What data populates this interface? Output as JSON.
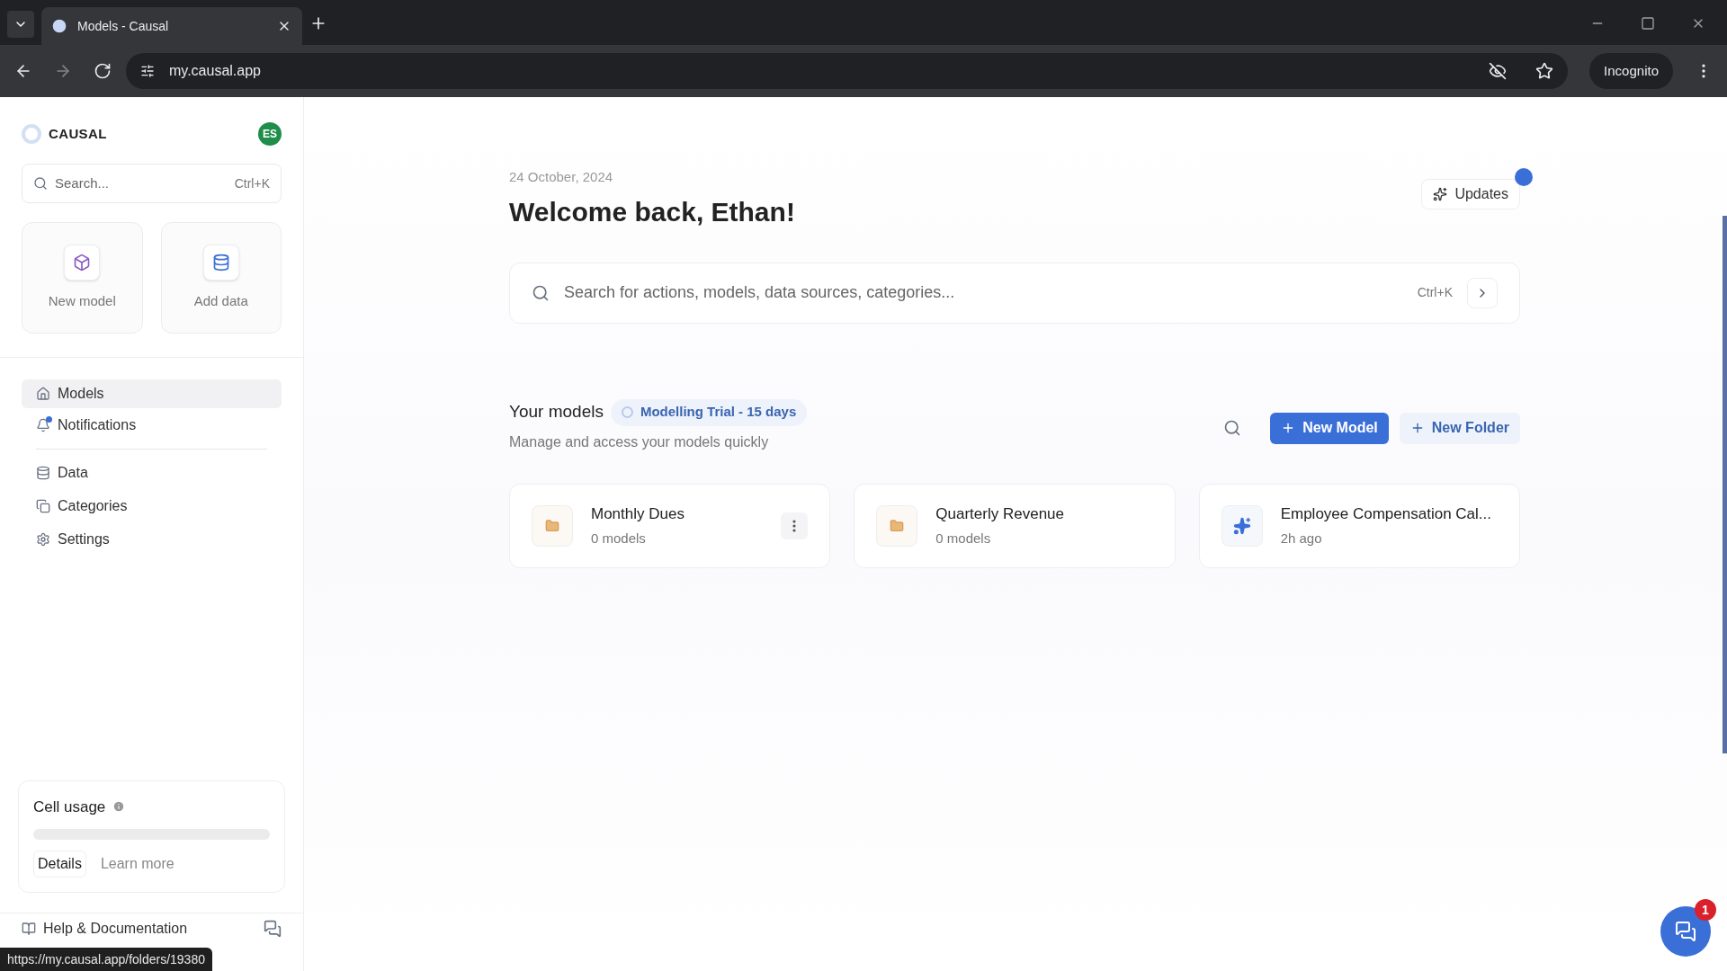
{
  "browser": {
    "tab_title": "Models - Causal",
    "url": "my.causal.app",
    "profile": "Incognito"
  },
  "sidebar": {
    "brand": "CAUSAL",
    "avatar": "ES",
    "search": {
      "placeholder": "Search...",
      "shortcut": "Ctrl+K"
    },
    "quick_actions": [
      {
        "kind": "model",
        "label": "New model"
      },
      {
        "kind": "data",
        "label": "Add data"
      }
    ],
    "nav": [
      {
        "kind": "home",
        "label": "Models",
        "selected": true,
        "dot": false
      },
      {
        "kind": "bell",
        "label": "Notifications",
        "selected": false,
        "dot": true
      }
    ],
    "nav2": [
      {
        "kind": "data",
        "label": "Data",
        "selected": false
      },
      {
        "kind": "categories",
        "label": "Categories",
        "selected": false
      },
      {
        "kind": "settings",
        "label": "Settings",
        "selected": false
      }
    ],
    "cell_usage": {
      "title": "Cell usage",
      "details": "Details",
      "learn_more": "Learn more"
    },
    "help": "Help & Documentation"
  },
  "main": {
    "date": "24 October, 2024",
    "greeting": "Welcome back, Ethan!",
    "updates": {
      "label": "Updates",
      "unread": true
    },
    "search": {
      "placeholder": "Search for actions, models, data sources, categories...",
      "shortcut": "Ctrl+K"
    },
    "models_title": "Your models",
    "trial_badge": "Modelling Trial - 15 days",
    "models_subtitle": "Manage and access your models quickly",
    "new_model": "New Model",
    "new_folder": "New Folder",
    "cards": [
      {
        "kind": "folder",
        "title": "Monthly Dues",
        "meta": "0 models",
        "menu_visible": true
      },
      {
        "kind": "folder",
        "title": "Quarterly Revenue",
        "meta": "0 models",
        "menu_visible": false
      },
      {
        "kind": "model",
        "title": "Employee Compensation Cal...",
        "meta": "2h ago",
        "menu_visible": false
      }
    ]
  },
  "chat": {
    "badge": "1"
  },
  "status_url": "https://my.causal.app/folders/19380"
}
